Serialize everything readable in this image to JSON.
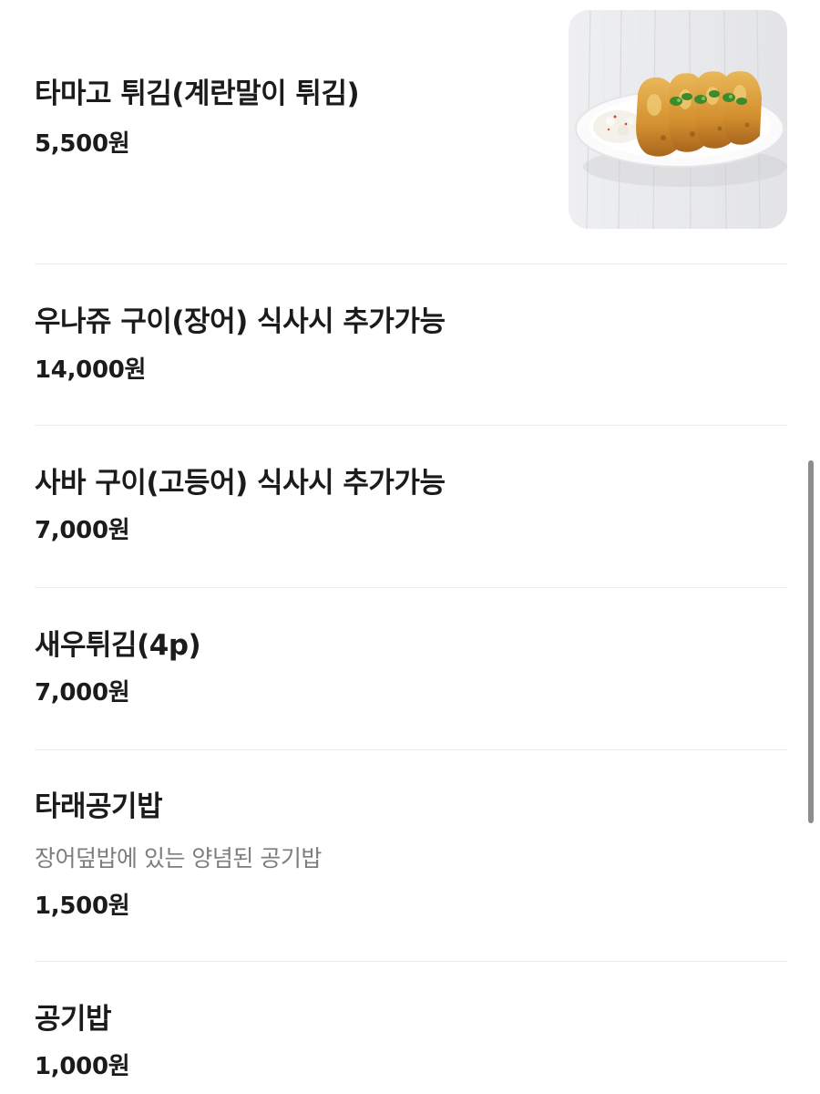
{
  "menu": {
    "items": [
      {
        "name": "타마고 튀김(계란말이 튀김)",
        "price": "5,500원",
        "image_icon": "rolled-omelette-photo"
      },
      {
        "name": "우나쥬 구이(장어) 식사시 추가가능",
        "price": "14,000원"
      },
      {
        "name": "사바 구이(고등어) 식사시 추가가능",
        "price": "7,000원"
      },
      {
        "name": "새우튀김(4p)",
        "price": "7,000원"
      },
      {
        "name": "타래공기밥",
        "description": "장어덮밥에 있는 양념된 공기밥",
        "price": "1,500원"
      },
      {
        "name": "공기밥",
        "price": "1,000원"
      }
    ]
  },
  "colors": {
    "text": "#1b1b1b",
    "description": "#7d7d7d",
    "divider": "#ececec",
    "scrollbar": "#8d8d8d"
  }
}
